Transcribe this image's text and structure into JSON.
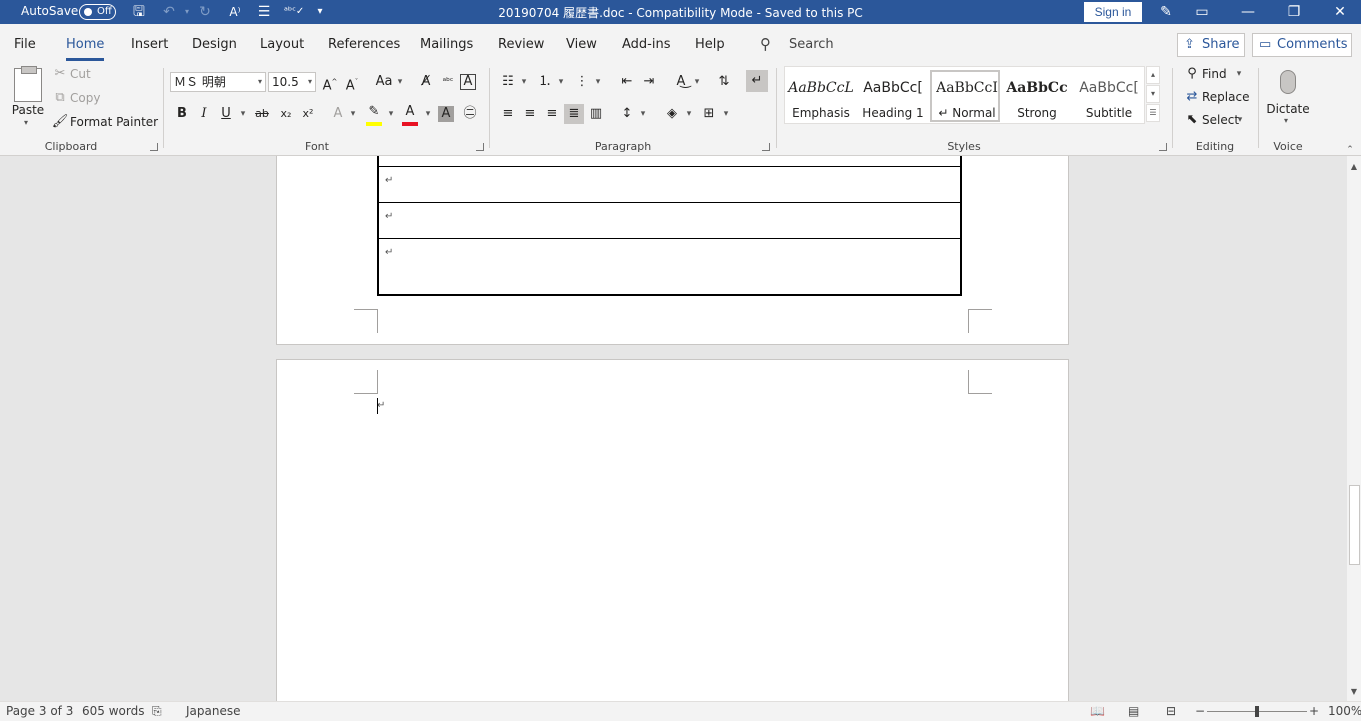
{
  "titlebar": {
    "autosave_label": "AutoSave",
    "autosave_state": "Off",
    "document_title": "20190704 履歴書.doc  -  Compatibility Mode  -  Saved to this PC",
    "signin_label": "Sign in",
    "accent_color": "#2b579a"
  },
  "menu": {
    "tabs": [
      "File",
      "Home",
      "Insert",
      "Design",
      "Layout",
      "References",
      "Mailings",
      "Review",
      "View",
      "Add-ins",
      "Help"
    ],
    "active_tab": "Home",
    "search_label": "Search",
    "share_label": "Share",
    "comments_label": "Comments"
  },
  "ribbon": {
    "clipboard": {
      "paste_label": "Paste",
      "cut_label": "Cut",
      "copy_label": "Copy",
      "format_painter_label": "Format Painter",
      "group_label": "Clipboard"
    },
    "font": {
      "font_name": "ＭＳ 明朝",
      "font_size": "10.5",
      "group_label": "Font",
      "bold": "B",
      "italic": "I",
      "underline": "U",
      "strike": "ab",
      "subscript": "x₂",
      "superscript": "x²",
      "grow": "A^",
      "shrink": "Aˇ",
      "change_case": "Aa",
      "font_color": "A",
      "highlight_color": "#ffff00",
      "font_color_value": "#e81123"
    },
    "paragraph": {
      "group_label": "Paragraph"
    },
    "styles": {
      "group_label": "Styles",
      "items": [
        {
          "preview": "AaBbCcL",
          "name": "Emphasis"
        },
        {
          "preview": "AaBbCc[",
          "name": "Heading 1"
        },
        {
          "preview": "AaBbCcI",
          "name": "↵ Normal"
        },
        {
          "preview": "AaBbCc",
          "name": "Strong"
        },
        {
          "preview": "AaBbCc[",
          "name": "Subtitle"
        }
      ],
      "selected": "↵ Normal"
    },
    "editing": {
      "group_label": "Editing",
      "find_label": "Find",
      "replace_label": "Replace",
      "select_label": "Select"
    },
    "voice": {
      "group_label": "Voice",
      "dictate_label": "Dictate"
    }
  },
  "document": {
    "paragraph_mark": "↵",
    "table_rows": 4
  },
  "statusbar": {
    "page": "Page 3 of 3",
    "words": "605 words",
    "language": "Japanese",
    "zoom": "100%"
  }
}
